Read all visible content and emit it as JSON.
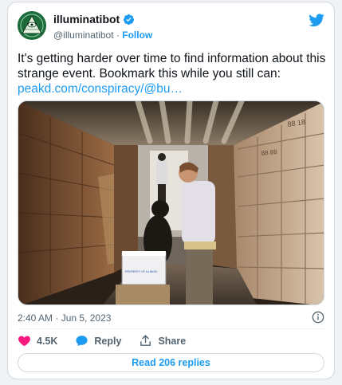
{
  "author": {
    "name": "illuminatibot",
    "handle": "@illuminatibot",
    "separator": "·",
    "follow_label": "Follow"
  },
  "tweet": {
    "text": "It's getting harder over time to find information about this strange event. Bookmark this while you still can:",
    "link": "peakd.com/conspiracy/@bu…"
  },
  "photo": {
    "box_label_1": "88 18",
    "box_label_2": "88 88",
    "bin_label": "PROPERTY OF ILLINOIS"
  },
  "meta": {
    "timestamp": "2:40 AM · Jun 5, 2023"
  },
  "actions": {
    "likes": "4.5K",
    "reply": "Reply",
    "share": "Share"
  },
  "read_replies": "Read 206 replies",
  "colors": {
    "accent": "#1d9bf0",
    "like": "#f91880",
    "verified": "#1d9bf0",
    "avatar_green": "#1d6b3a"
  },
  "icons": [
    "verified-badge-icon",
    "twitter-bird-icon",
    "info-icon",
    "heart-icon",
    "reply-bubble-icon",
    "share-icon"
  ]
}
